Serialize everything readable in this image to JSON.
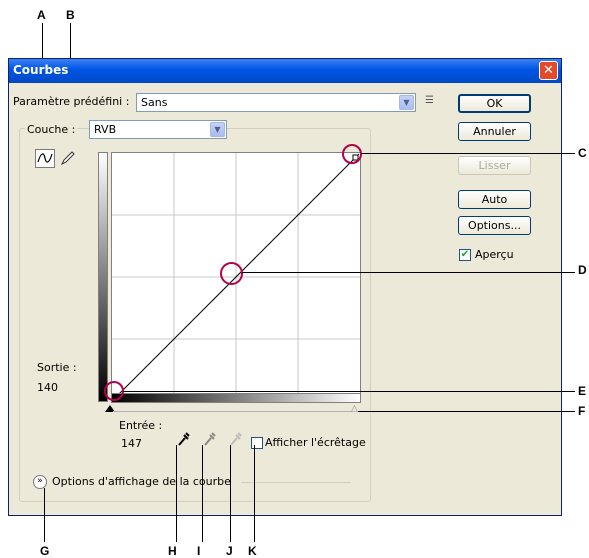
{
  "window": {
    "title": "Courbes",
    "close_glyph": "✕"
  },
  "preset": {
    "label": "Paramètre prédéfini :",
    "value": "Sans"
  },
  "channel": {
    "label": "Couche :",
    "value": "RVB"
  },
  "buttons": {
    "ok": "OK",
    "cancel": "Annuler",
    "smooth": "Lisser",
    "auto": "Auto",
    "options": "Options..."
  },
  "preview": {
    "label": "Aperçu",
    "checked": true
  },
  "output": {
    "label": "Sortie :",
    "value": "140"
  },
  "input": {
    "label": "Entrée :",
    "value": "147"
  },
  "show_clipping": {
    "label": "Afficher l'écrêtage",
    "checked": false
  },
  "curve_display_options": {
    "label": "Options d'affichage de la courbe"
  },
  "callouts": [
    "A",
    "B",
    "C",
    "D",
    "E",
    "F",
    "G",
    "H",
    "I",
    "J",
    "K"
  ],
  "colors": {
    "highlight_circle": "#b5004a",
    "titlebar": "#0055e5",
    "dialog_bg": "#ece9d8"
  },
  "icons": [
    "curve-tool-icon",
    "pencil-tool-icon",
    "preset-menu-icon",
    "black-eyedropper-icon",
    "gray-eyedropper-icon",
    "white-eyedropper-icon",
    "expand-chevron-icon",
    "close-icon"
  ]
}
